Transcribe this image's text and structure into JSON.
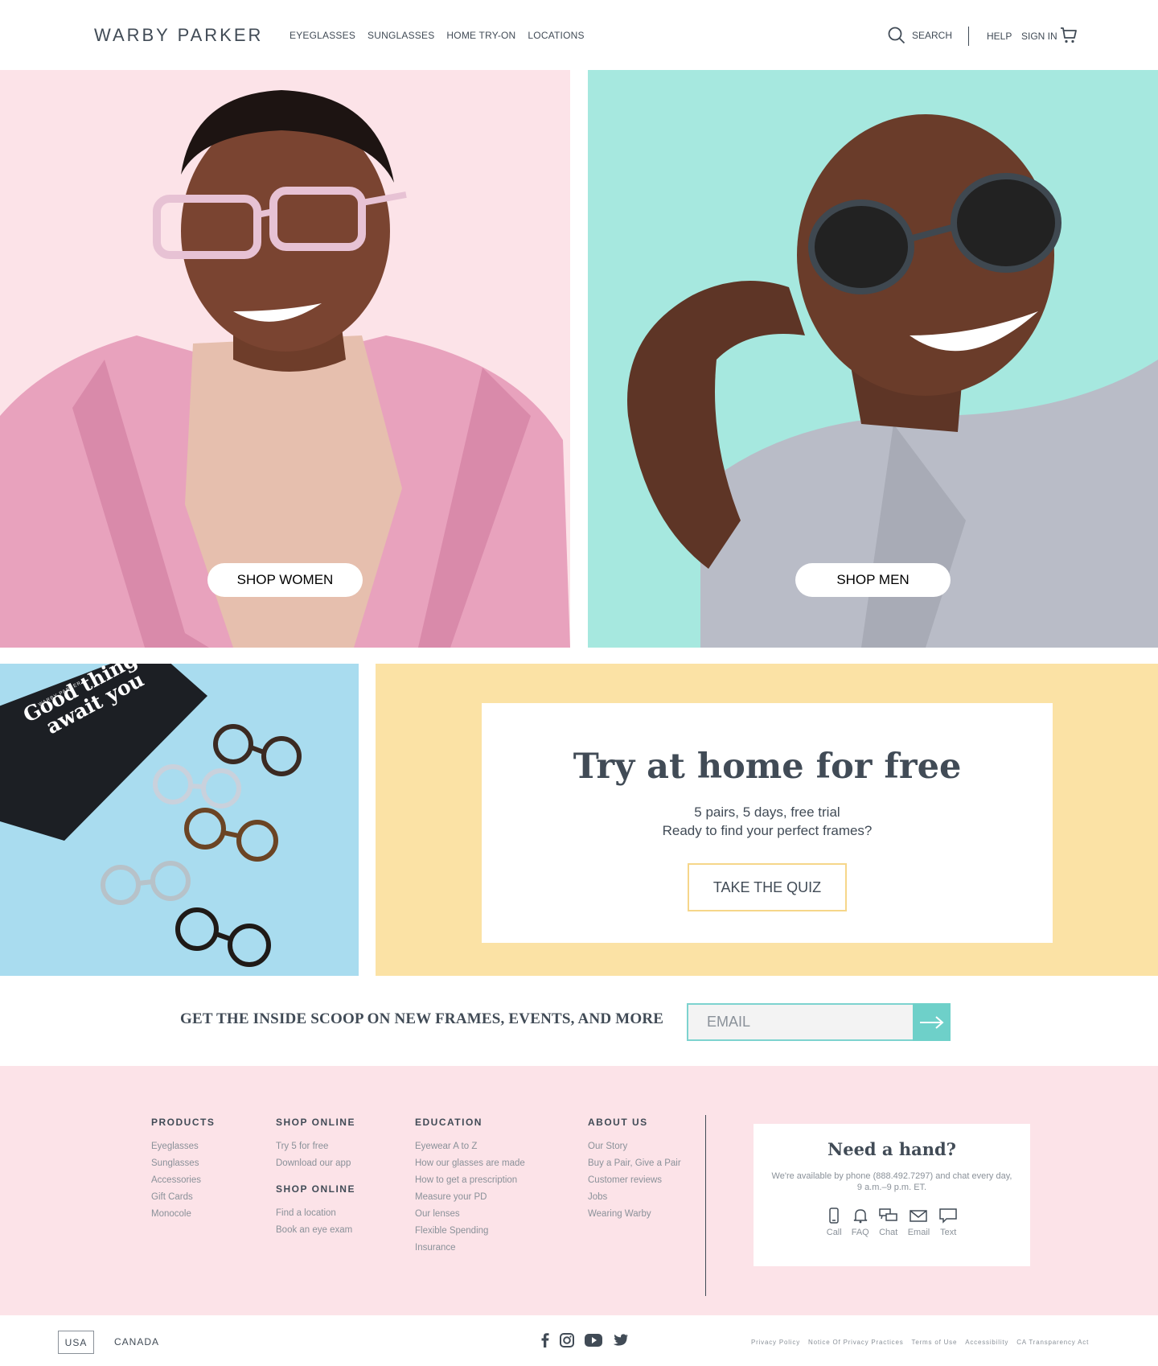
{
  "header": {
    "logo": "WARBY PARKER",
    "nav": [
      "EYEGLASSES",
      "SUNGLASSES",
      "HOME TRY-ON",
      "LOCATIONS"
    ],
    "search_label": "SEARCH",
    "help_label": "HELP",
    "signin_label": "SIGN IN"
  },
  "hero": {
    "women_button": "SHOP WOMEN",
    "men_button": "SHOP MEN"
  },
  "box_image": {
    "brand": "WARBY PARKER",
    "line1": "Good things",
    "line2": "await you"
  },
  "try_home": {
    "title": "Try at home for free",
    "line1": "5 pairs, 5 days, free trial",
    "line2": "Ready to find your perfect frames?",
    "button": "TAKE THE QUIZ"
  },
  "newsletter": {
    "text": "GET THE INSIDE SCOOP ON NEW FRAMES, EVENTS, AND MORE",
    "placeholder": "EMAIL"
  },
  "footer": {
    "products": {
      "heading": "PRODUCTS",
      "links": [
        "Eyeglasses",
        "Sunglasses",
        "Accessories",
        "Gift Cards",
        "Monocole"
      ]
    },
    "shop_online": {
      "heading": "SHOP ONLINE",
      "links": [
        "Try 5 for free",
        "Download our app"
      ],
      "heading2": "SHOP ONLINE",
      "links2": [
        "Find a location",
        "Book an eye exam"
      ]
    },
    "education": {
      "heading": "EDUCATION",
      "links": [
        "Eyewear A to Z",
        "How our glasses are made",
        "How to get a prescription",
        "Measure your PD",
        "Our lenses",
        "Flexible Spending",
        "Insurance"
      ]
    },
    "about": {
      "heading": "ABOUT US",
      "links": [
        "Our Story",
        "Buy a Pair, Give a Pair",
        "Customer reviews",
        "Jobs",
        "Wearing Warby"
      ]
    },
    "help": {
      "title": "Need a hand?",
      "text": "We're available by phone (888.492.7297) and chat every day, 9 a.m.–9 p.m. ET.",
      "icons": [
        {
          "label": "Call",
          "icon": "phone-icon"
        },
        {
          "label": "FAQ",
          "icon": "bell-icon"
        },
        {
          "label": "Chat",
          "icon": "chat-icon"
        },
        {
          "label": "Email",
          "icon": "mail-icon"
        },
        {
          "label": "Text",
          "icon": "text-bubble-icon"
        }
      ]
    }
  },
  "bottom": {
    "usa": "USA",
    "canada": "CANADA",
    "legal": [
      "Privacy Policy",
      "Notice Of Privacy Practices",
      "Terms of Use",
      "Accessibility",
      "CA Transparency Act"
    ]
  },
  "colors": {
    "text": "#414b56",
    "muted": "#8a9199",
    "pink": "#fce3e8",
    "mint": "#a6e8df",
    "yellow": "#fbe2a5",
    "teal_button": "#6ed0c9",
    "blue_image": "#a9dcef"
  }
}
